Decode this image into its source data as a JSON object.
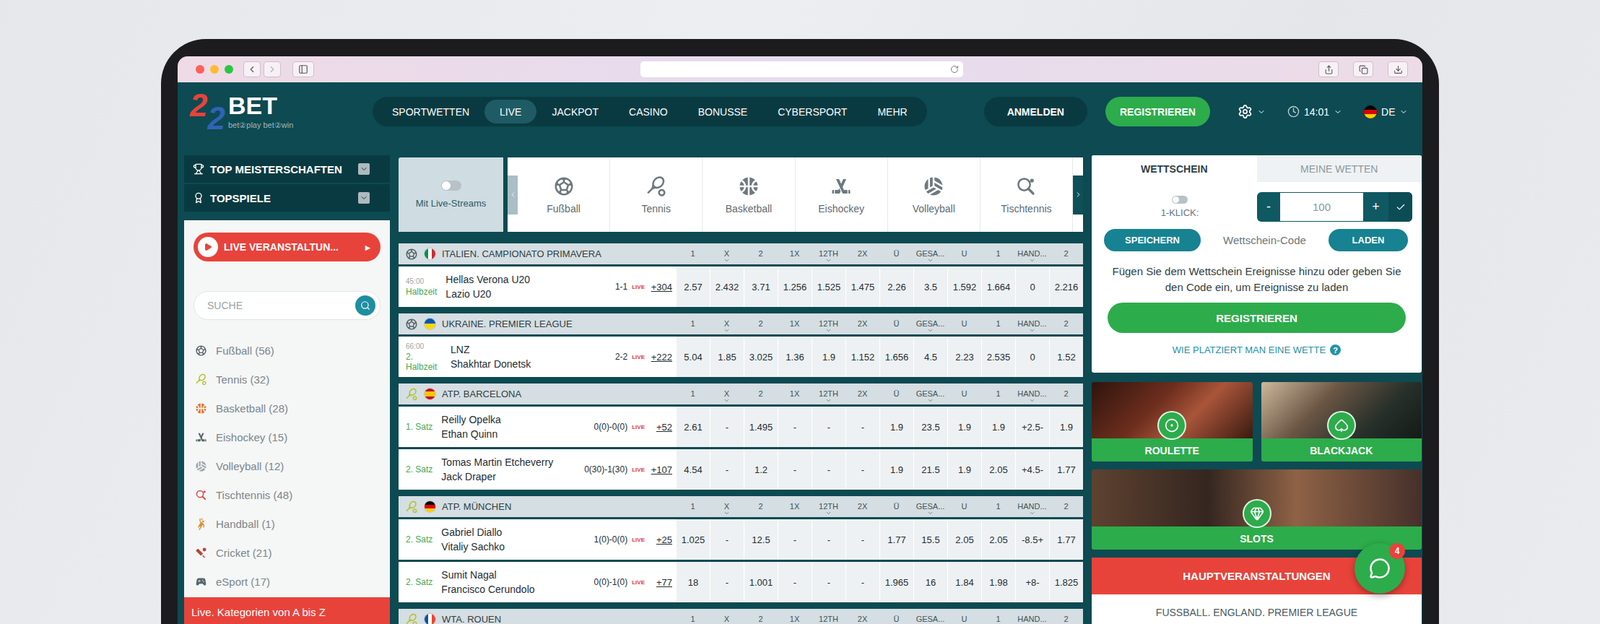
{
  "header": {
    "logo": {
      "digits": [
        "2",
        "2"
      ],
      "word": "BET",
      "tagline": "bet②play bet②win"
    },
    "nav": [
      {
        "label": "SPORTWETTEN",
        "selected": false
      },
      {
        "label": "LIVE",
        "selected": true
      },
      {
        "label": "JACKPOT",
        "selected": false
      },
      {
        "label": "CASINO",
        "selected": false
      },
      {
        "label": "BONUSSE",
        "selected": false
      },
      {
        "label": "CYBERSPORT",
        "selected": false
      },
      {
        "label": "MEHR",
        "selected": false
      }
    ],
    "login": "ANMELDEN",
    "register": "REGISTRIEREN",
    "time": "14:01",
    "language": {
      "label": "DE",
      "flag_colors": [
        "#000000",
        "#dd0000",
        "#ffce00"
      ],
      "stripes": "horizontal"
    }
  },
  "sidebar": {
    "sections": [
      {
        "label": "TOP MEISTERSCHAFTEN",
        "kind": "trophy",
        "expanded": false
      },
      {
        "label": "TOPSPIELE",
        "kind": "award",
        "expanded": false
      }
    ],
    "live_button": {
      "label": "LIVE VERANSTALTUN...",
      "arrow": "▸"
    },
    "search": {
      "placeholder": "SUCHE"
    },
    "sports": [
      {
        "label": "Fußball (56)",
        "kind": "football"
      },
      {
        "label": "Tennis (32)",
        "kind": "tennis"
      },
      {
        "label": "Basketball (28)",
        "kind": "basketball"
      },
      {
        "label": "Eishockey (15)",
        "kind": "icehockey"
      },
      {
        "label": "Volleyball (12)",
        "kind": "volleyball"
      },
      {
        "label": "Tischtennis (48)",
        "kind": "tabletennis"
      },
      {
        "label": "Handball (1)",
        "kind": "handball"
      },
      {
        "label": "Cricket (21)",
        "kind": "cricket"
      },
      {
        "label": "eSport (17)",
        "kind": "esport"
      }
    ],
    "footer": "Live. Kategorien von A bis Z"
  },
  "filters": {
    "stream": {
      "label": "Mit Live-Streams",
      "on": false
    },
    "sports": [
      {
        "label": "Fußball",
        "kind": "football",
        "selected": false
      },
      {
        "label": "Tennis",
        "kind": "tennis",
        "selected": false
      },
      {
        "label": "Basketball",
        "kind": "basketball",
        "selected": false
      },
      {
        "label": "Eishockey",
        "kind": "icehockey",
        "selected": false
      },
      {
        "label": "Volleyball",
        "kind": "volleyball",
        "selected": false
      },
      {
        "label": "Tischtennis",
        "kind": "tabletennis",
        "selected": false
      }
    ]
  },
  "table": {
    "columns": [
      {
        "label": "1",
        "dropdown": false
      },
      {
        "label": "X",
        "dropdown": true
      },
      {
        "label": "2",
        "dropdown": false
      },
      {
        "label": "1X",
        "dropdown": false
      },
      {
        "label": "12TH",
        "dropdown": true
      },
      {
        "label": "2X",
        "dropdown": false
      },
      {
        "label": "Ü",
        "dropdown": false
      },
      {
        "label": "GESA...",
        "dropdown": true
      },
      {
        "label": "U",
        "dropdown": false
      },
      {
        "label": "1",
        "dropdown": false
      },
      {
        "label": "HAND...",
        "dropdown": true
      },
      {
        "label": "2",
        "dropdown": false
      }
    ],
    "leagues": [
      {
        "name": "ITALIEN. CAMPIONATO PRIMAVERA",
        "kind": "football",
        "flag_colors": [
          "#009246",
          "#ffffff",
          "#ce2b37"
        ],
        "stripes": "vertical",
        "events": [
          {
            "time": "45:00",
            "period": "Halbzeit",
            "home": "Hellas Verona U20",
            "away": "Lazio U20",
            "score": "1-1",
            "live": "LIVE",
            "more": "+304",
            "odds": [
              "2.57",
              "2.432",
              "3.71",
              "1.256",
              "1.525",
              "1.475",
              "2.26",
              "3.5",
              "1.592",
              "1.664",
              "0",
              "2.216"
            ]
          }
        ]
      },
      {
        "name": "UKRAINE. PREMIER LEAGUE",
        "kind": "football",
        "flag_colors": [
          "#0057b7",
          "#ffd700"
        ],
        "stripes": "horizontal",
        "events": [
          {
            "time": "66:00",
            "period": "2. Halbzeit",
            "home": "LNZ",
            "away": "Shakhtar Donetsk",
            "score": "2-2",
            "live": "LIVE",
            "more": "+222",
            "odds": [
              "5.04",
              "1.85",
              "3.025",
              "1.36",
              "1.9",
              "1.152",
              "1.656",
              "4.5",
              "2.23",
              "2.535",
              "0",
              "1.52"
            ]
          }
        ]
      },
      {
        "name": "ATP. BARCELONA",
        "kind": "tennis",
        "flag_colors": [
          "#c60b1e",
          "#ffc400",
          "#ffc400",
          "#c60b1e"
        ],
        "stripes": "horizontal",
        "events": [
          {
            "period": "1. Satz",
            "home": "Reilly Opelka",
            "away": "Ethan Quinn",
            "score": "0(0)-0(0)",
            "live": "LIVE",
            "more": "+52",
            "odds": [
              "2.61",
              "-",
              "1.495",
              "-",
              "-",
              "-",
              "1.9",
              "23.5",
              "1.9",
              "1.9",
              "+2.5-",
              "1.9"
            ]
          },
          {
            "period": "2. Satz",
            "home": "Tomas Martin Etcheverry",
            "away": "Jack Draper",
            "score": "0(30)-1(30)",
            "live": "LIVE",
            "more": "+107",
            "odds": [
              "4.54",
              "-",
              "1.2",
              "-",
              "-",
              "-",
              "1.9",
              "21.5",
              "1.9",
              "2.05",
              "+4.5-",
              "1.77"
            ]
          }
        ]
      },
      {
        "name": "ATP. MÜNCHEN",
        "kind": "tennis",
        "flag_colors": [
          "#000000",
          "#dd0000",
          "#ffce00"
        ],
        "stripes": "horizontal",
        "events": [
          {
            "period": "2. Satz",
            "home": "Gabriel Diallo",
            "away": "Vitaliy Sachko",
            "score": "1(0)-0(0)",
            "live": "LIVE",
            "more": "+25",
            "odds": [
              "1.025",
              "-",
              "12.5",
              "-",
              "-",
              "-",
              "1.77",
              "15.5",
              "2.05",
              "2.05",
              "-8.5+",
              "1.77"
            ]
          },
          {
            "period": "2. Satz",
            "home": "Sumit Nagal",
            "away": "Francisco Cerundolo",
            "score": "0(0)-1(0)",
            "live": "LIVE",
            "more": "+77",
            "odds": [
              "18",
              "-",
              "1.001",
              "-",
              "-",
              "-",
              "1.965",
              "16",
              "1.84",
              "1.98",
              "+8-",
              "1.825"
            ]
          }
        ]
      },
      {
        "name": "WTA. ROUEN",
        "kind": "tennis",
        "flag_colors": [
          "#0055a4",
          "#ffffff",
          "#ef4135"
        ],
        "stripes": "vertical",
        "events": []
      }
    ]
  },
  "betslip": {
    "tabs": [
      {
        "label": "WETTSCHEIN",
        "selected": true
      },
      {
        "label": "MEINE WETTEN",
        "selected": false
      }
    ],
    "one_click": {
      "label": "1-KLICK:",
      "on": false
    },
    "stake": {
      "minus": "-",
      "value": "100",
      "plus": "+"
    },
    "save": "SPEICHERN",
    "code_label": "Wettschein-Code",
    "load": "LADEN",
    "message": "Fügen Sie dem Wettschein Ereignisse hinzu oder geben Sie den Code ein, um Ereignisse zu laden",
    "register": "REGISTRIEREN",
    "help": {
      "label": "WIE PLATZIERT MAN EINE WETTE",
      "icon": "?"
    }
  },
  "casino": [
    {
      "label": "ROULETTE",
      "kind": "roulette"
    },
    {
      "label": "BLACKJACK",
      "kind": "blackjack"
    },
    {
      "label": "SLOTS",
      "kind": "slots"
    }
  ],
  "main_events": {
    "title": "HAUPTVERANSTALTUNGEN",
    "first": "FUSSBALL. ENGLAND. PREMIER LEAGUE"
  },
  "chat": {
    "badge": "4"
  }
}
